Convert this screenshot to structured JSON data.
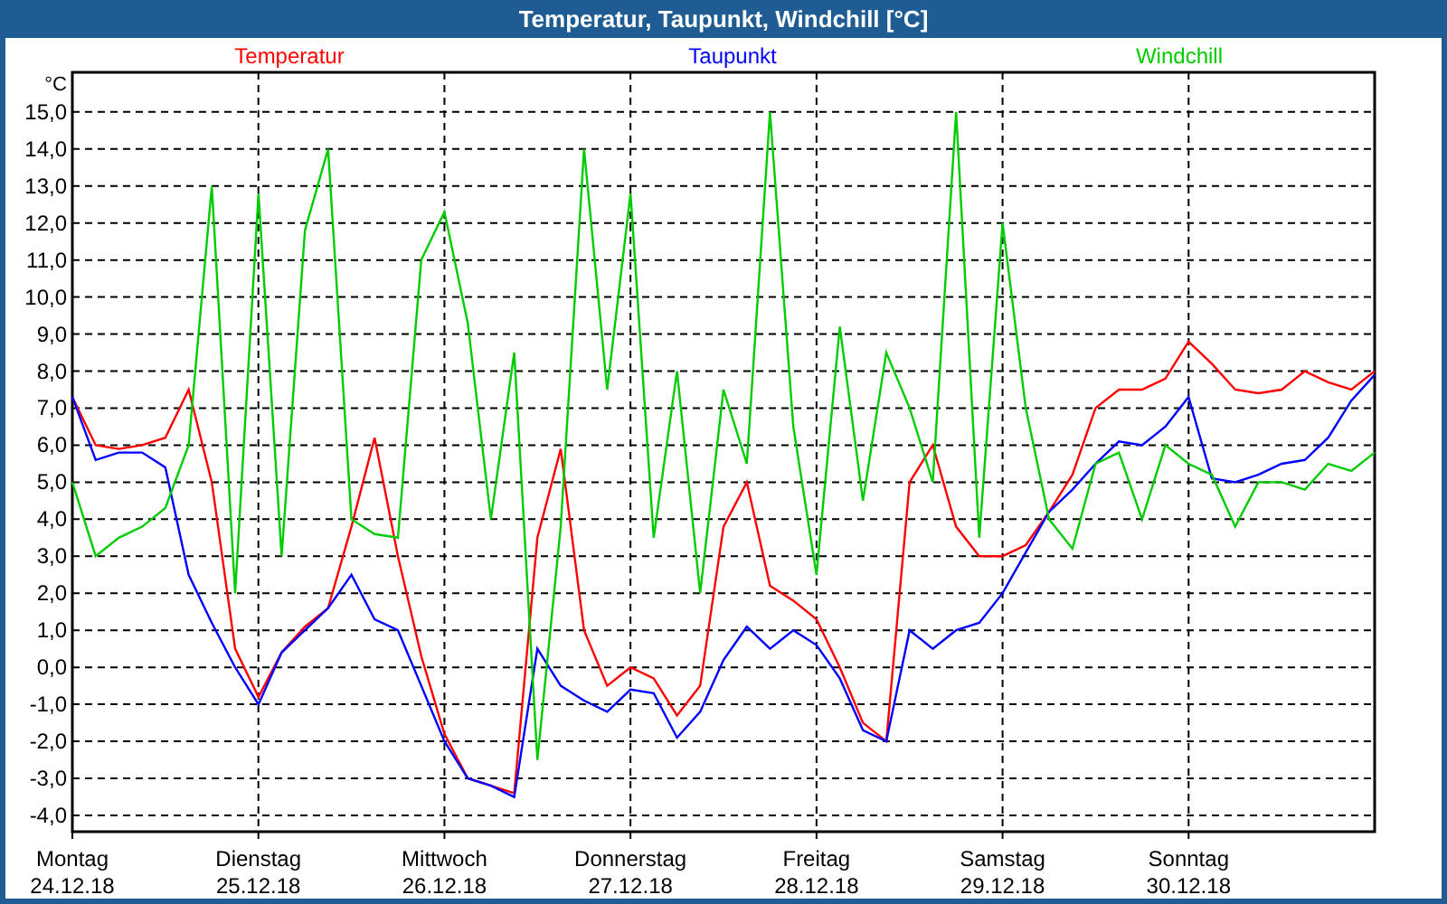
{
  "window": {
    "title": "Temperatur, Taupunkt, Windchill [°C]"
  },
  "chart": {
    "tick_dates": [
      "24.12.18",
      "25.12.18",
      "26.12.18",
      "27.12.18",
      "28.12.18",
      "29.12.18",
      "30.12.18"
    ],
    "chart_data": {
      "type": "line",
      "grid": true,
      "ylabel": "°C",
      "ylim": [
        -4.44,
        16.07
      ],
      "yticks": [
        {
          "value": -4,
          "label": "-4,0"
        },
        {
          "value": -3,
          "label": "-3,0"
        },
        {
          "value": -2,
          "label": "-2,0"
        },
        {
          "value": -1,
          "label": "-1,0"
        },
        {
          "value": 0,
          "label": "0,0"
        },
        {
          "value": 1,
          "label": "1,0"
        },
        {
          "value": 2,
          "label": "2,0"
        },
        {
          "value": 3,
          "label": "3,0"
        },
        {
          "value": 4,
          "label": "4,0"
        },
        {
          "value": 5,
          "label": "5,0"
        },
        {
          "value": 6,
          "label": "6,0"
        },
        {
          "value": 7,
          "label": "7,0"
        },
        {
          "value": 8,
          "label": "8,0"
        },
        {
          "value": 9,
          "label": "9,0"
        },
        {
          "value": 10,
          "label": "10,0"
        },
        {
          "value": 11,
          "label": "11,0"
        },
        {
          "value": 12,
          "label": "12,0"
        },
        {
          "value": 13,
          "label": "13,0"
        },
        {
          "value": 14,
          "label": "14,0"
        },
        {
          "value": 15,
          "label": "15,0"
        }
      ],
      "categories": [
        "Montag",
        null,
        null,
        null,
        null,
        null,
        null,
        null,
        "Dienstag",
        null,
        null,
        null,
        null,
        null,
        null,
        null,
        "Mittwoch",
        null,
        null,
        null,
        null,
        null,
        null,
        null,
        "Donnerstag",
        null,
        null,
        null,
        null,
        null,
        null,
        null,
        "Freitag",
        null,
        null,
        null,
        null,
        null,
        null,
        null,
        "Samstag",
        null,
        null,
        null,
        null,
        null,
        null,
        null,
        "Sonntag",
        null,
        null,
        null,
        null,
        null,
        null,
        null,
        null
      ],
      "series": [
        {
          "name": "Temperatur",
          "color": "#ff0000",
          "values": [
            7.3,
            6.0,
            5.9,
            6.0,
            6.2,
            7.5,
            5.0,
            0.5,
            -0.8,
            0.4,
            1.1,
            1.6,
            3.8,
            6.2,
            3.0,
            0.3,
            -1.8,
            -3.0,
            -3.2,
            -3.4,
            3.5,
            5.9,
            1.0,
            -0.5,
            0.0,
            -0.3,
            -1.3,
            -0.5,
            3.8,
            5.0,
            2.2,
            1.8,
            1.3,
            0.0,
            -1.5,
            -2.0,
            5.0,
            6.0,
            3.8,
            3.0,
            3.0,
            3.3,
            4.2,
            5.2,
            7.0,
            7.5,
            7.5,
            7.8,
            8.8,
            8.2,
            7.5,
            7.4,
            7.5,
            8.0,
            7.7,
            7.5,
            8.0
          ]
        },
        {
          "name": "Taupunkt",
          "color": "#0000ff",
          "values": [
            7.3,
            5.6,
            5.8,
            5.8,
            5.4,
            2.5,
            1.2,
            0.0,
            -1.0,
            0.4,
            1.0,
            1.6,
            2.5,
            1.3,
            1.0,
            -0.5,
            -2.0,
            -3.0,
            -3.2,
            -3.5,
            0.5,
            -0.5,
            -0.9,
            -1.2,
            -0.6,
            -0.7,
            -1.9,
            -1.2,
            0.2,
            1.1,
            0.5,
            1.0,
            0.6,
            -0.3,
            -1.7,
            -2.0,
            1.0,
            0.5,
            1.0,
            1.2,
            2.0,
            3.1,
            4.2,
            4.8,
            5.5,
            6.1,
            6.0,
            6.5,
            7.3,
            5.1,
            5.0,
            5.2,
            5.5,
            5.6,
            6.2,
            7.2,
            7.9
          ]
        },
        {
          "name": "Windchill",
          "color": "#00cc00",
          "values": [
            5.0,
            3.0,
            3.5,
            3.8,
            4.3,
            6.0,
            13.0,
            2.0,
            12.8,
            3.0,
            11.8,
            14.0,
            4.0,
            3.6,
            3.5,
            11.0,
            12.3,
            9.3,
            4.0,
            8.5,
            -2.5,
            3.8,
            14.0,
            7.5,
            12.8,
            3.5,
            8.0,
            2.0,
            7.5,
            5.5,
            15.0,
            6.5,
            2.5,
            9.2,
            4.5,
            8.5,
            7.0,
            5.0,
            15.0,
            3.5,
            12.0,
            7.0,
            4.0,
            3.2,
            5.5,
            5.8,
            4.0,
            6.0,
            5.5,
            5.2,
            3.8,
            5.0,
            5.0,
            4.8,
            5.5,
            5.3,
            5.8
          ]
        }
      ]
    }
  }
}
